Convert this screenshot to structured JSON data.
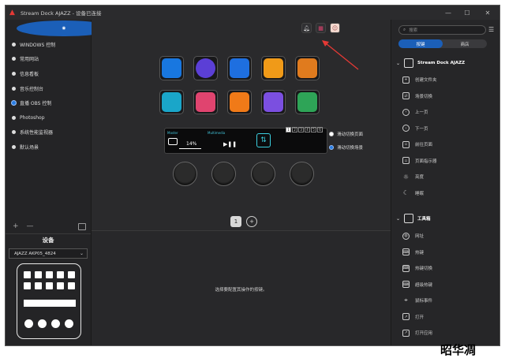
{
  "window": {
    "title": "Stream Dock AJAZZ - 设备已连接"
  },
  "left_panel": {
    "profiles": [
      {
        "label": "WINDOWS 控制",
        "selected": false
      },
      {
        "label": "常用网站",
        "selected": false
      },
      {
        "label": "信息看板",
        "selected": false
      },
      {
        "label": "音乐控制台",
        "selected": false
      },
      {
        "label": "直播 OBS 控制",
        "selected": true
      },
      {
        "label": "Photoshop",
        "selected": false
      },
      {
        "label": "系统性能监视器",
        "selected": false
      },
      {
        "label": "默认场景",
        "selected": false
      }
    ],
    "add_label": "+",
    "remove_label": "—",
    "device_title": "设备",
    "device_name": "AJAZZ AKP05_4824"
  },
  "center": {
    "key_colors": [
      "#1877e0",
      "#5b3fd6",
      "#1e6fe0",
      "#f09a18",
      "#e07b1e",
      "#1aa6c9",
      "#e0446f",
      "#f07a18",
      "#7b4fe0",
      "#2ea457"
    ],
    "screen": {
      "left_label": "Master",
      "mid_label": "Multimedia",
      "percent": "14%",
      "pages": [
        "1",
        "2",
        "3",
        "4",
        "5",
        "6"
      ],
      "active_page": "1"
    },
    "radio1": "滑动切换页面",
    "radio2": "滑动切换场景",
    "page_number": "1",
    "add_page": "+",
    "placeholder": "选择要配置其操作的按键。"
  },
  "right_panel": {
    "search_placeholder": "搜索",
    "tab_actions": "按键",
    "tab_store": "商店",
    "category1": "Stream Dock AJAZZ",
    "actions1": [
      "创建文件夹",
      "场景切换",
      "上一页",
      "下一页",
      "前往页面",
      "页面指示器",
      "亮度",
      "睡眠"
    ],
    "category2": "工具箱",
    "actions2": [
      "网址",
      "热键",
      "热键切换",
      "超级热键",
      "鼠标事件",
      "打开",
      "打开应用"
    ]
  },
  "watermark": "昭华凋"
}
